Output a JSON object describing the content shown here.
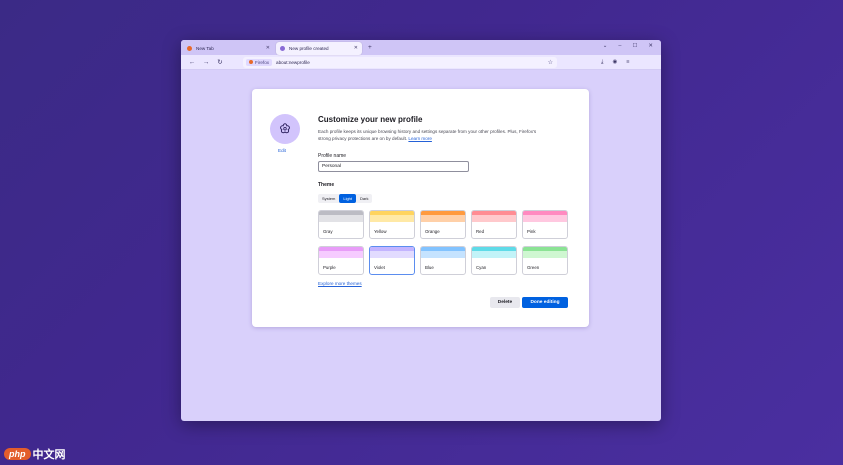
{
  "browser": {
    "tabs": [
      {
        "title": "New Tab",
        "active": false,
        "favicon_color": "#e86a2a"
      },
      {
        "title": "New profile created",
        "active": true,
        "favicon_color": "#8a6bd6"
      }
    ],
    "url": "about:newprofile",
    "identity_label": "Firefox"
  },
  "profile_card": {
    "title": "Customize your new profile",
    "description": "Each profile keeps its unique browsing history and settings separate from your other profiles. Plus, Firefox's strong privacy protections are on by default.",
    "learn_more": "Learn more",
    "edit_label": "Edit",
    "name_label": "Profile name",
    "name_value": "Personal",
    "theme_label": "Theme",
    "theme_modes": [
      "System",
      "Light",
      "Dark"
    ],
    "selected_mode": "Light",
    "themes": [
      {
        "name": "Gray",
        "color": "#e2e2e6",
        "strip": "#bcbcc4",
        "selected": false
      },
      {
        "name": "Yellow",
        "color": "#ffe9a6",
        "strip": "#ffd45e",
        "selected": false
      },
      {
        "name": "Orange",
        "color": "#ffd0a8",
        "strip": "#ff9a3e",
        "selected": false
      },
      {
        "name": "Red",
        "color": "#ffc9cc",
        "strip": "#ff8c93",
        "selected": false
      },
      {
        "name": "Pink",
        "color": "#ffc8e0",
        "strip": "#ff8ac0",
        "selected": false
      },
      {
        "name": "Purple",
        "color": "#f6cbff",
        "strip": "#e89cf8",
        "selected": false
      },
      {
        "name": "Violet",
        "color": "#e2dbff",
        "strip": "#c3b4ff",
        "selected": true
      },
      {
        "name": "Blue",
        "color": "#c5e3ff",
        "strip": "#82c3ff",
        "selected": false
      },
      {
        "name": "Cyan",
        "color": "#c2f3f8",
        "strip": "#5fdbe8",
        "selected": false
      },
      {
        "name": "Green",
        "color": "#cff7d1",
        "strip": "#8be394",
        "selected": false
      }
    ],
    "explore_link": "Explore more themes",
    "delete_button": "Delete",
    "done_button": "Done editing"
  },
  "watermark": {
    "badge": "php",
    "text": "中文网"
  }
}
